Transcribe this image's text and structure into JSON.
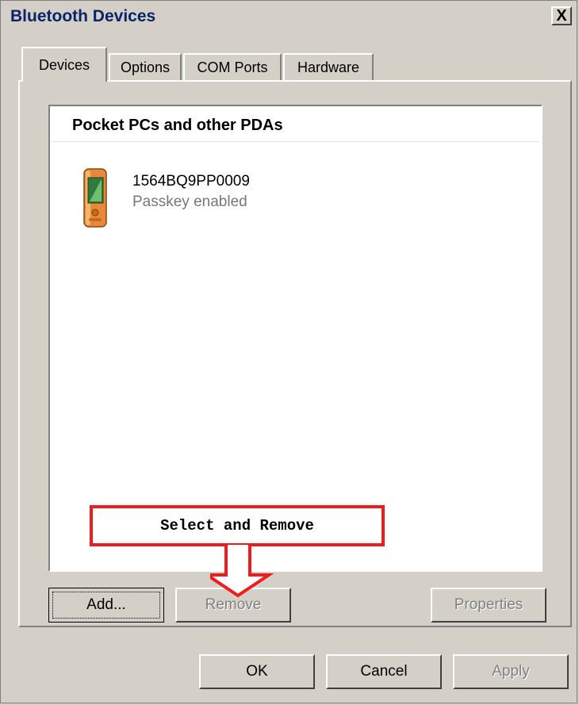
{
  "window": {
    "title": "Bluetooth Devices",
    "close_label": "X"
  },
  "tabs": [
    {
      "label": "Devices",
      "active": true
    },
    {
      "label": "Options",
      "active": false
    },
    {
      "label": "COM Ports",
      "active": false
    },
    {
      "label": "Hardware",
      "active": false
    }
  ],
  "device_list": {
    "group_header": "Pocket PCs and other PDAs",
    "items": [
      {
        "name": "1564BQ9PP0009",
        "status": "Passkey enabled",
        "icon": "pda-icon"
      }
    ]
  },
  "panel_buttons": {
    "add": "Add...",
    "remove": "Remove",
    "properties": "Properties"
  },
  "annotation": {
    "text": "Select and Remove",
    "color": "#ee1c1c"
  },
  "dialog_buttons": {
    "ok": "OK",
    "cancel": "Cancel",
    "apply": "Apply"
  }
}
